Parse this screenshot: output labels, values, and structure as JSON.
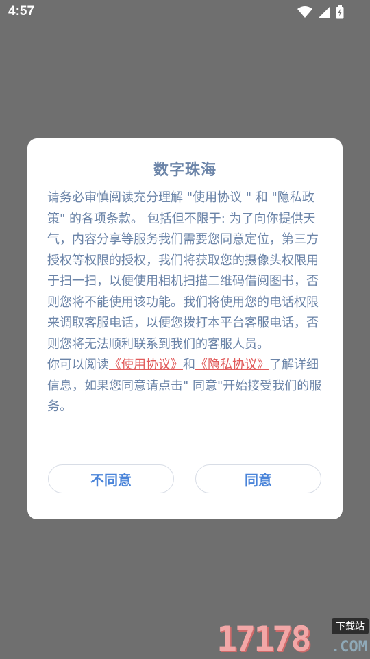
{
  "status_bar": {
    "time": "4:57",
    "icons": [
      "wifi-icon",
      "signal-icon",
      "battery-charging-icon"
    ]
  },
  "dialog": {
    "title": "数字珠海",
    "paragraph1": "请务必审慎阅读充分理解 \"使用协议 \" 和 \"隐私政策\" 的各项条款。 包括但不限于: 为了向你提供天气，内容分享等服务我们需要您同意定位，第三方授权等权限的授权，我们将获取您的摄像头权限用于扫一扫，以便使用相机扫描二维码借阅图书，否则您将不能使用该功能。我们将使用您的电话权限来调取客服电话，以便您拨打本平台客服电话，否则您将无法顺利联系到我们的客服人员。",
    "p2_prefix": "你可以阅读",
    "link_usage": "《使用协议》",
    "p2_and": "和",
    "link_privacy": "《隐私协议》",
    "p2_suffix": "了解详细信息，如果您同意请点击\" 同意\"开始接受我们的服务。",
    "disagree_label": "不同意",
    "agree_label": "同意"
  },
  "watermark": {
    "digits": "17178",
    "tag": "下载站",
    "domain": ".COM"
  },
  "colors": {
    "overlay": "#6f6f6f",
    "text": "#6b84a8",
    "link": "#e15b5b",
    "button_text": "#4a84d9"
  }
}
